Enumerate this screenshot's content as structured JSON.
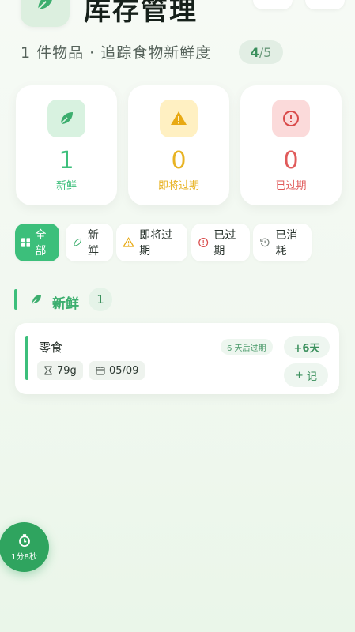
{
  "header": {
    "title": "库存管理",
    "subtitle": "1 件物品 · 追踪食物新鲜度",
    "page_current": "4",
    "page_separator": "/",
    "page_total": "5"
  },
  "stats": [
    {
      "value": "1",
      "label": "新鲜",
      "color": "#3cbf7b",
      "icon": "leaf-icon"
    },
    {
      "value": "0",
      "label": "即将过期",
      "color": "#e8b323",
      "icon": "warning-icon"
    },
    {
      "value": "0",
      "label": "已过期",
      "color": "#e05a5a",
      "icon": "alert-circle-icon"
    }
  ],
  "filters": [
    {
      "label": "全部",
      "icon": "grid-icon",
      "active": true
    },
    {
      "label": "新鲜",
      "icon": "leaf-icon"
    },
    {
      "label": "即将过期",
      "icon": "warning-icon"
    },
    {
      "label": "已过期",
      "icon": "alert-circle-icon"
    },
    {
      "label": "已消耗",
      "icon": "history-icon"
    }
  ],
  "section": {
    "title": "新鲜",
    "count": "1"
  },
  "item": {
    "name": "零食",
    "weight": "79g",
    "date": "05/09",
    "expiry_text": "6 天后过期",
    "plus_days": "+6天",
    "record_label": "记"
  },
  "timer": {
    "label": "1分8秒"
  }
}
